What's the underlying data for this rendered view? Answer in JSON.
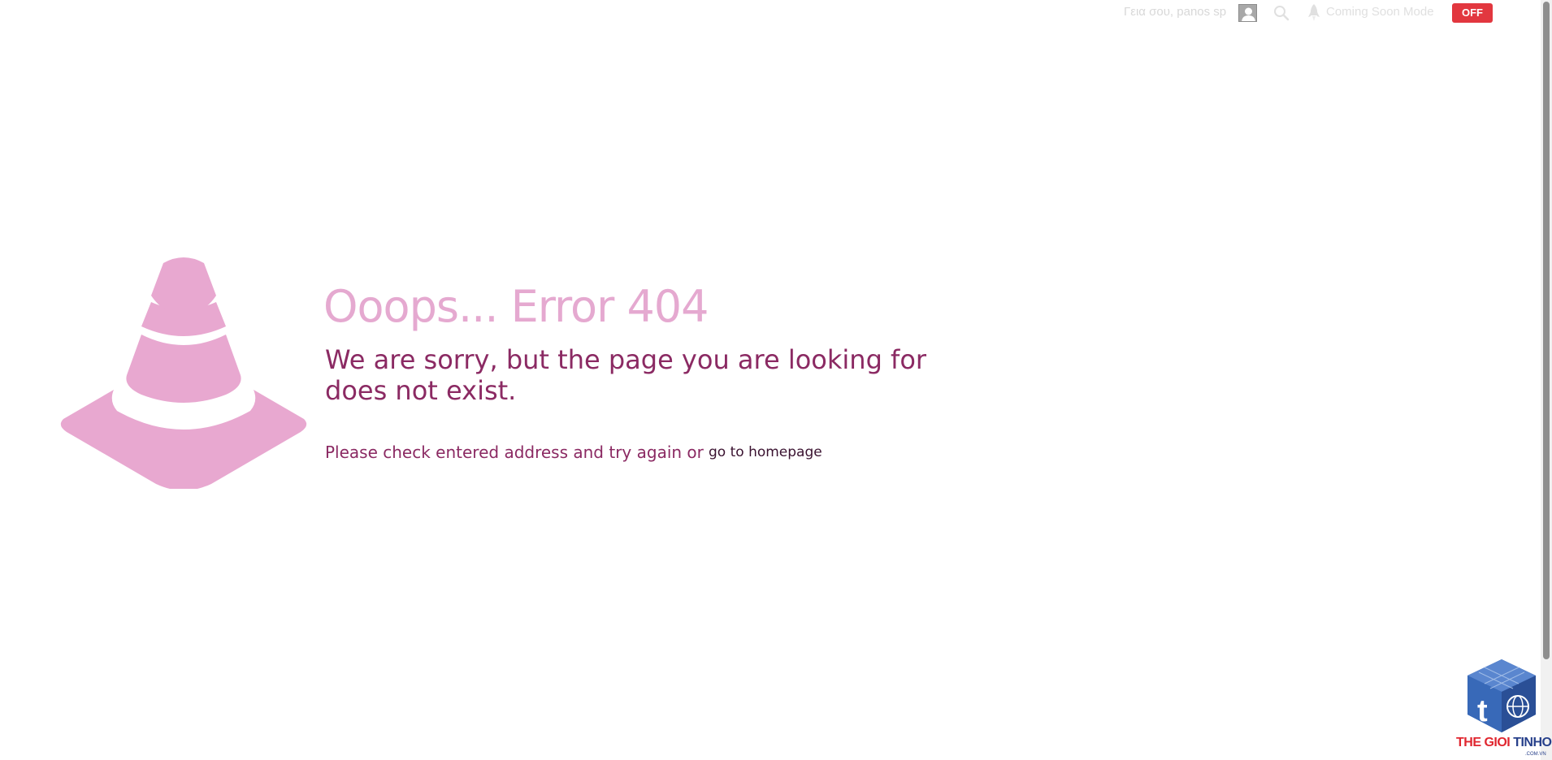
{
  "topbar": {
    "greeting": "Γεια σου, panos sp",
    "coming_soon_label": "Coming Soon Mode",
    "off_badge": "OFF",
    "colors": {
      "badge": "#e2373f"
    },
    "icons": [
      "user-avatar",
      "search-icon",
      "rocket-icon"
    ]
  },
  "error": {
    "title": "Ooops... Error 404",
    "subtitle": "We are sorry, but the page you are looking for does not exist.",
    "hint": "Please check entered address and try again or",
    "homepage_link": "go to homepage",
    "colors": {
      "title": "#e5a9d0",
      "text": "#8b2a63",
      "cone": "#e8a8d0"
    }
  },
  "logo": {
    "part1": "THE GIOI",
    "part2": "TINHOC",
    "sub": ".COM.VN"
  }
}
